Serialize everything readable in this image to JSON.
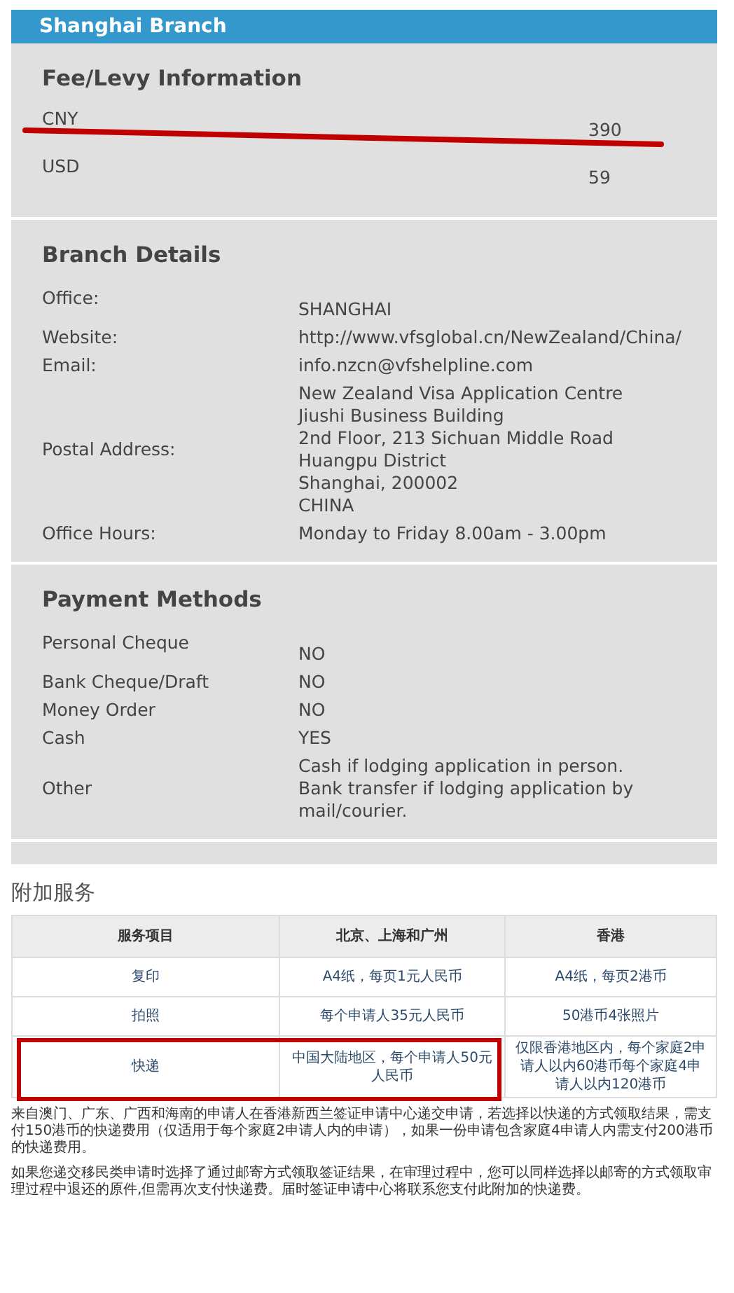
{
  "branch_header": "Shanghai Branch",
  "sections": [
    {
      "kind": "fees",
      "title": "Fee/Levy Information",
      "rows": [
        {
          "label": "CNY",
          "lines": [
            "390"
          ],
          "struck": true
        },
        {
          "label": "USD",
          "lines": [
            "59"
          ],
          "struck": false
        }
      ]
    },
    {
      "kind": "details",
      "title": "Branch Details",
      "rows": [
        {
          "label": "Office:",
          "lines": [
            "SHANGHAI"
          ]
        },
        {
          "label": "Website:",
          "lines": [
            "http://www.vfsglobal.cn/NewZealand/China/"
          ]
        },
        {
          "label": "Email:",
          "lines": [
            "info.nzcn@vfshelpline.com"
          ]
        },
        {
          "label": "Postal Address:",
          "lines": [
            "New Zealand Visa Application Centre",
            "Jiushi Business Building",
            "2nd Floor, 213 Sichuan Middle Road",
            "Huangpu District",
            "Shanghai, 200002",
            "CHINA"
          ]
        },
        {
          "label": "Office Hours:",
          "lines": [
            "Monday to Friday 8.00am - 3.00pm"
          ]
        }
      ]
    },
    {
      "kind": "details",
      "title": "Payment Methods",
      "rows": [
        {
          "label": "Personal Cheque",
          "lines": [
            "NO"
          ]
        },
        {
          "label": "Bank Cheque/Draft",
          "lines": [
            "NO"
          ]
        },
        {
          "label": "Money Order",
          "lines": [
            "NO"
          ]
        },
        {
          "label": "Cash",
          "lines": [
            "YES"
          ]
        },
        {
          "label": "Other",
          "lines": [
            "Cash if lodging application in person.",
            "Bank transfer if lodging application by mail/courier."
          ]
        }
      ]
    }
  ],
  "additional": {
    "title": "附加服务",
    "columns": [
      "服务项目",
      "北京、上海和广州",
      "香港"
    ],
    "rows": [
      {
        "cells": [
          "复印",
          "A4纸，每页1元人民币",
          "A4纸，每页2港币"
        ],
        "highlighted": false
      },
      {
        "cells": [
          "拍照",
          "每个申请人35元人民币",
          "50港币4张照片"
        ],
        "highlighted": false
      },
      {
        "cells": [
          "快递",
          "中国大陆地区，每个申请人50元人民币",
          "仅限香港地区内，每个家庭2申请人以内60港币每个家庭4申请人以内120港币"
        ],
        "highlighted": true
      }
    ],
    "notes": [
      "来自澳门、广东、广西和海南的申请人在香港新西兰签证申请中心递交申请，若选择以快递的方式领取结果，需支付150港币的快递费用（仅适用于每个家庭2申请人内的申请），如果一份申请包含家庭4申请人内需支付200港币的快递费用。",
      "如果您递交移民类申请时选择了通过邮寄方式领取签证结果，在审理过程中，您可以同样选择以邮寄的方式领取审理过程中退还的原件,但需再次支付快递费。届时签证申请中心将联系您支付此附加的快递费。"
    ]
  }
}
